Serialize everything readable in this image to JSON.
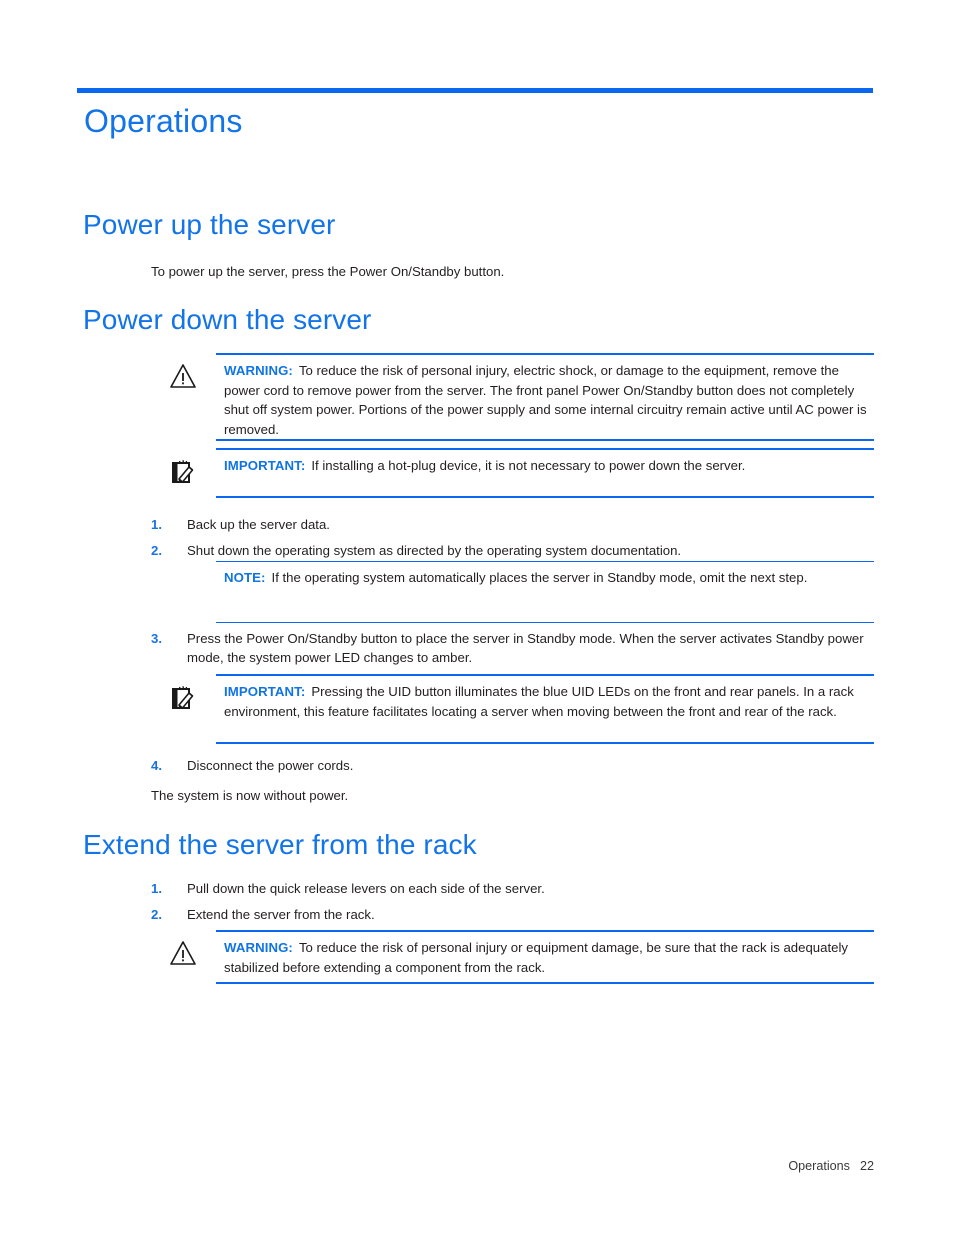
{
  "page": {
    "chapter_title": "Operations",
    "footer_section": "Operations",
    "footer_page_number": "22",
    "accent_color": "#1274e8",
    "rule_color": "#0b66f0",
    "body_color": "#231f20"
  },
  "sections": {
    "power_up": {
      "heading": "Power up the server",
      "paragraph": "To power up the server, press the Power On/Standby button."
    },
    "power_down": {
      "heading": "Power down the server",
      "closing_paragraph": "The system is now without power.",
      "warning": {
        "label": "WARNING:",
        "icon": "warning-triangle-icon",
        "text": "To reduce the risk of personal injury, electric shock, or damage to the equipment, remove the power cord to remove power from the server. The front panel Power On/Standby button does not completely shut off system power. Portions of the power supply and some internal circuitry remain active until AC power is removed."
      },
      "important_hotplug": {
        "label": "IMPORTANT:",
        "icon": "notepad-pencil-icon",
        "text": "If installing a hot-plug device, it is not necessary to power down the server."
      },
      "note_standby": {
        "label": "NOTE:",
        "text": "If the operating system automatically places the server in Standby mode, omit the next step."
      },
      "important_uid": {
        "label": "IMPORTANT:",
        "icon": "notepad-pencil-icon",
        "text": "Pressing the UID button illuminates the blue UID LEDs on the front and rear panels. In a rack environment, this feature facilitates locating a server when moving between the front and rear of the rack."
      },
      "steps": [
        {
          "number": "1.",
          "text": "Back up the server data."
        },
        {
          "number": "2.",
          "text": "Shut down the operating system as directed by the operating system documentation."
        },
        {
          "number": "3.",
          "text": "Press the Power On/Standby button to place the server in Standby mode. When the server activates Standby power mode, the system power LED changes to amber."
        },
        {
          "number": "4.",
          "text": "Disconnect the power cords."
        }
      ]
    },
    "extend_server": {
      "heading": "Extend the server from the rack",
      "steps": [
        {
          "number": "1.",
          "text": "Pull down the quick release levers on each side of the server."
        },
        {
          "number": "2.",
          "text": "Extend the server from the rack."
        }
      ],
      "warning": {
        "label": "WARNING:",
        "icon": "warning-triangle-icon",
        "text": "To reduce the risk of personal injury or equipment damage, be sure that the rack is adequately stabilized before extending a component from the rack."
      }
    }
  }
}
